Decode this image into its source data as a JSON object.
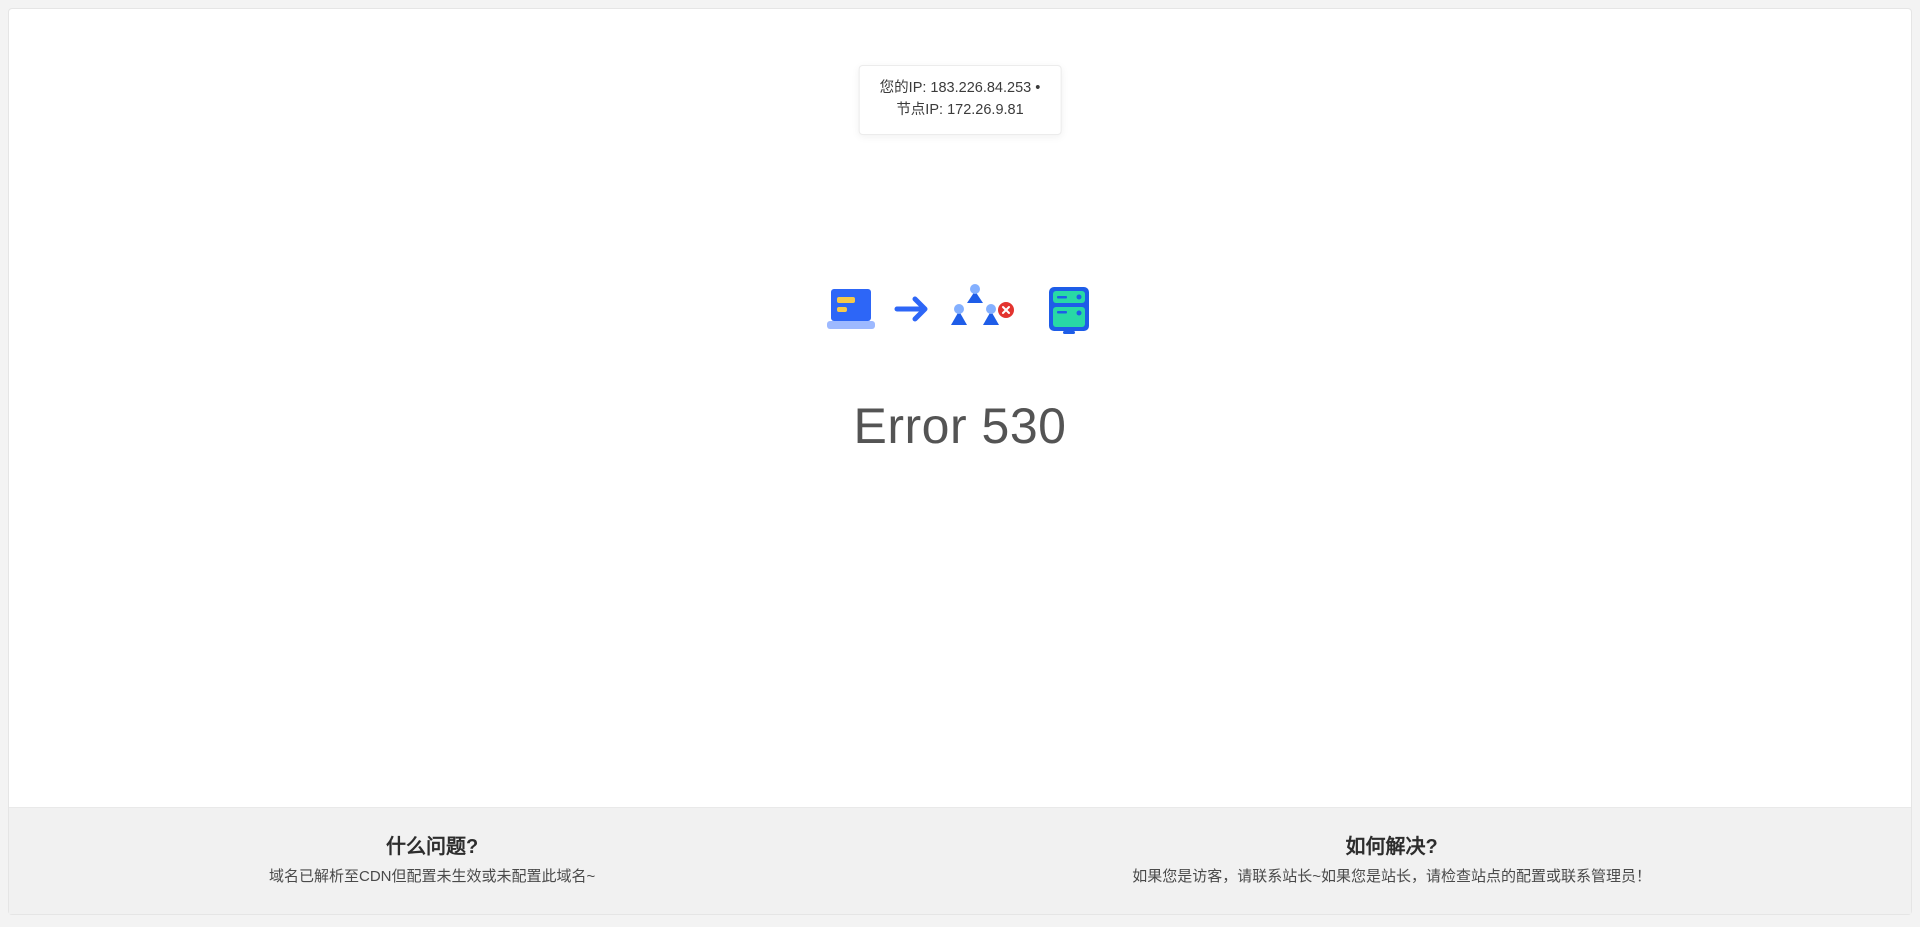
{
  "ip_info": {
    "line1": "您的IP: 183.226.84.253 •",
    "line2": "节点IP: 172.26.9.81"
  },
  "error": {
    "title": "Error 530"
  },
  "footer": {
    "left": {
      "heading": "什么问题?",
      "body": "域名已解析至CDN但配置未生效或未配置此域名~"
    },
    "right": {
      "heading": "如何解决?",
      "body": "如果您是访客，请联系站长~如果您是站长，请检查站点的配置或联系管理员！"
    }
  }
}
